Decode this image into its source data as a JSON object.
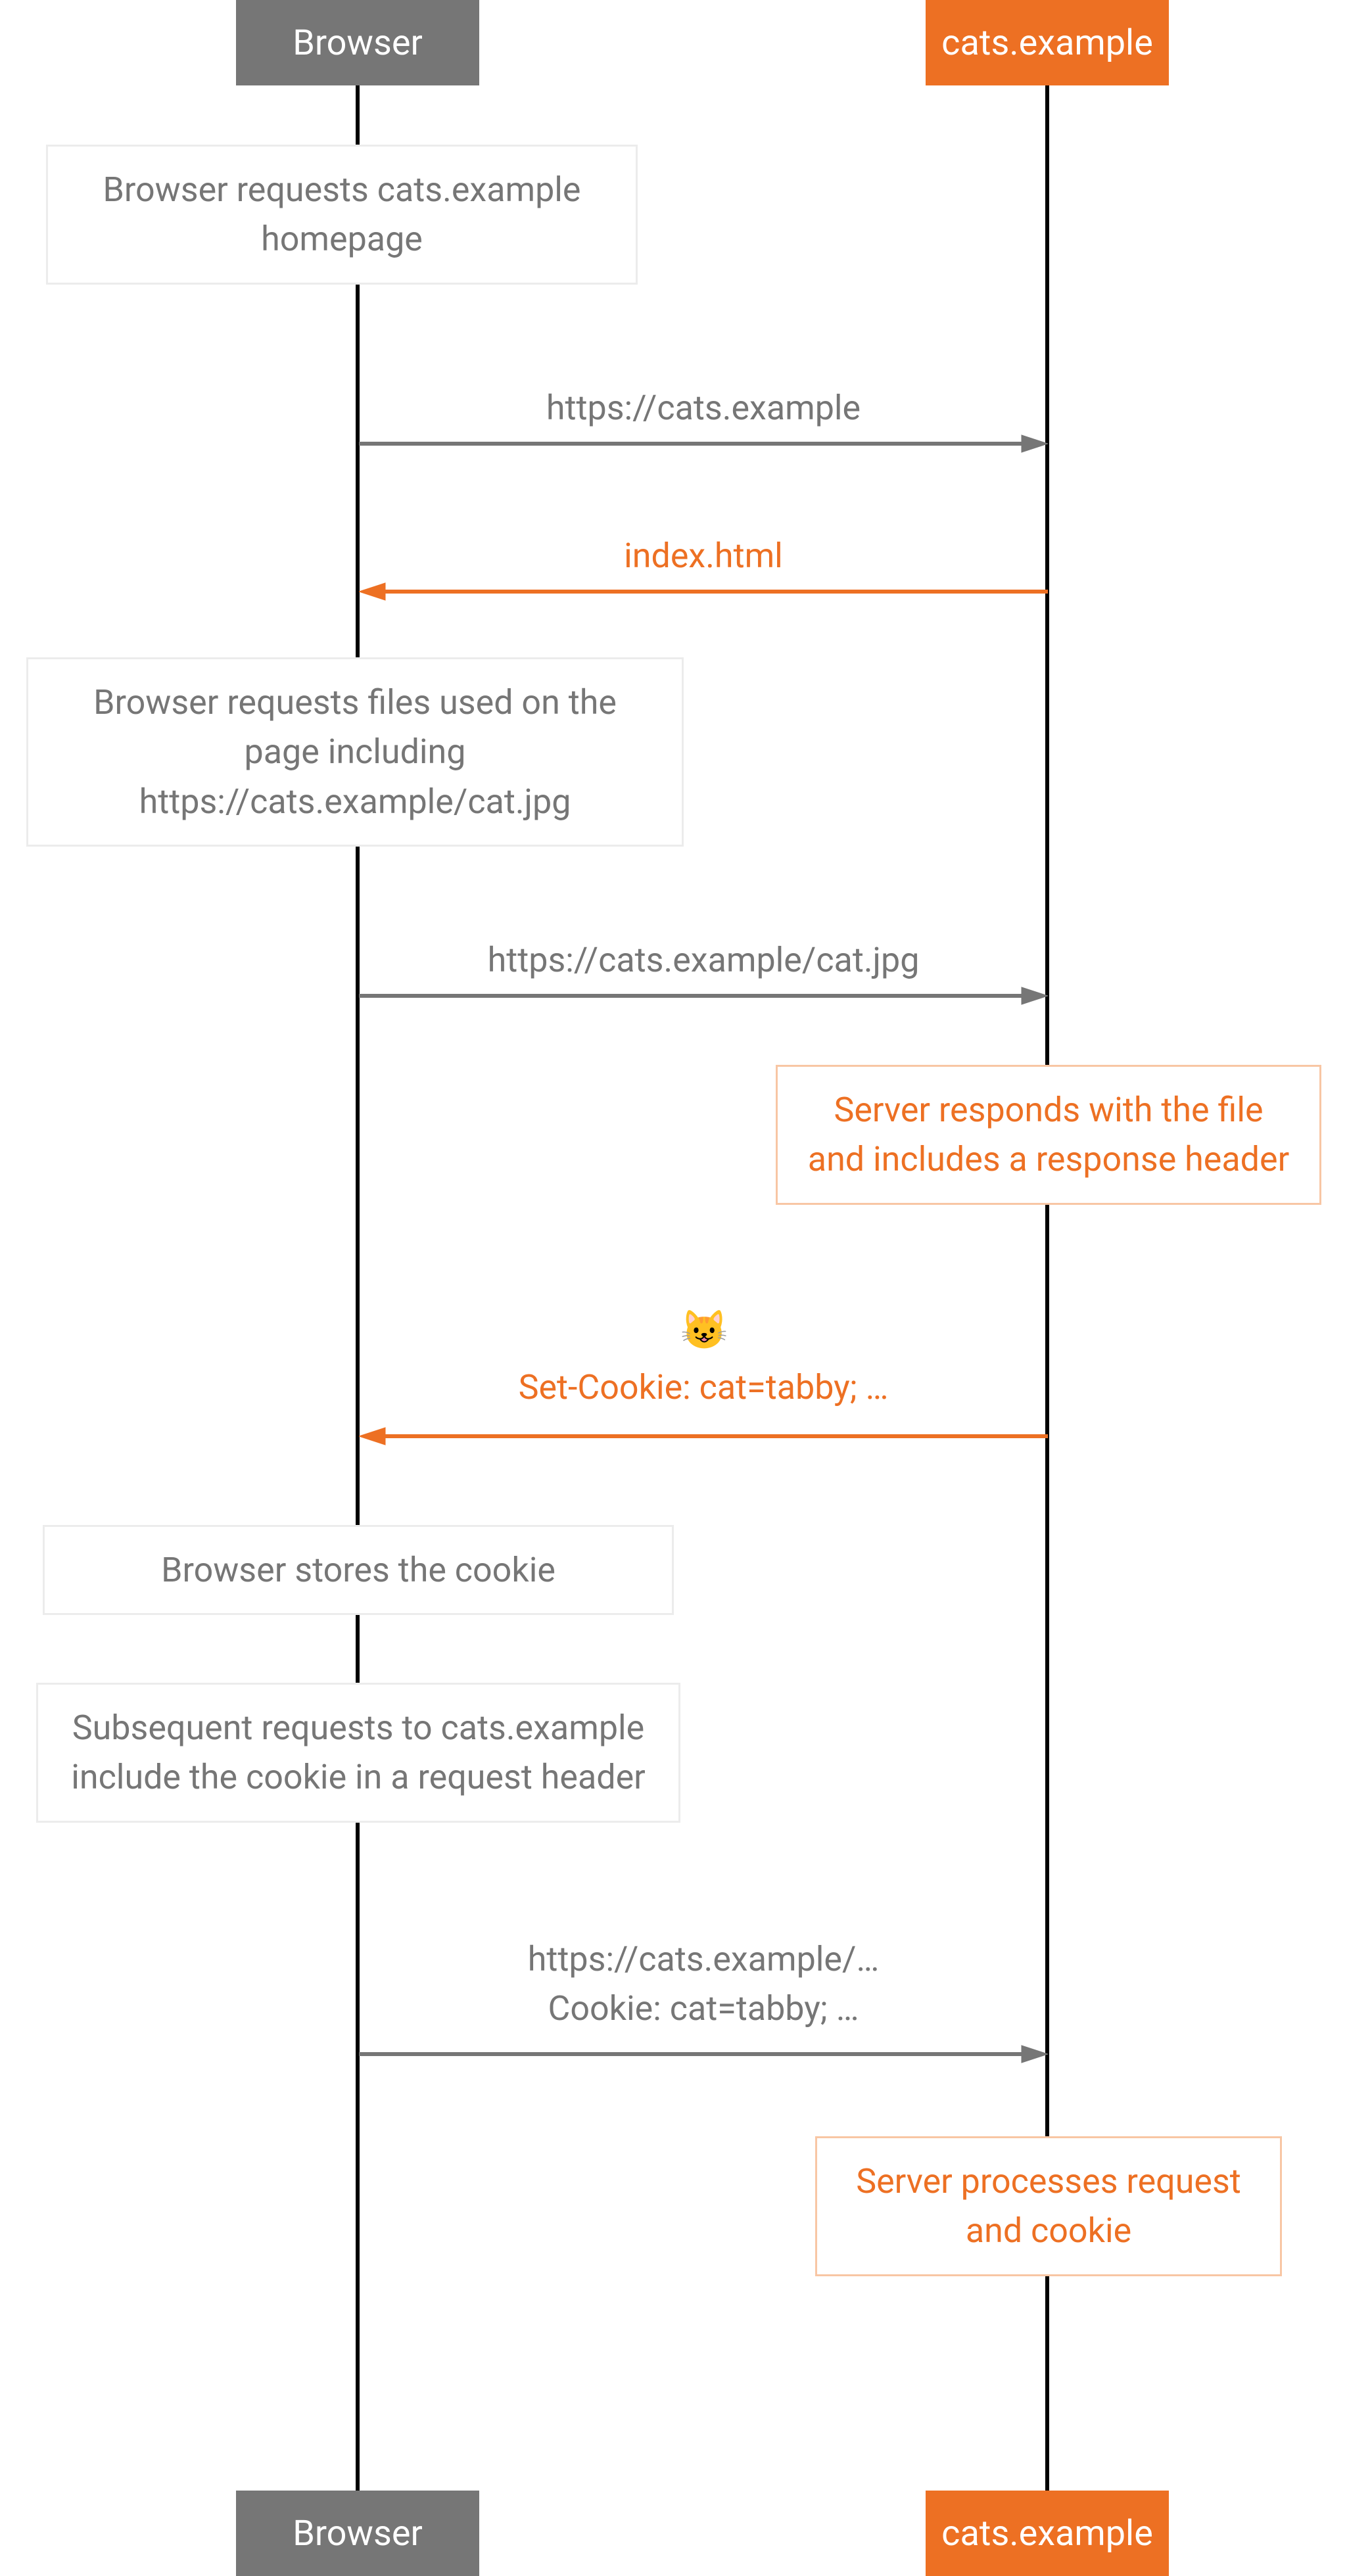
{
  "participants": {
    "browser": "Browser",
    "server": "cats.example"
  },
  "notes": {
    "n1": "Browser requests cats.example homepage",
    "n2": "Browser requests files used on the page including https://cats.example/cat.jpg",
    "n3": "Server responds with the file and includes a response header",
    "n4": "Browser stores the cookie",
    "n5": "Subsequent requests to cats.example include the cookie in a request header",
    "n6": "Server processes request and cookie"
  },
  "messages": {
    "m1": "https://cats.example",
    "m2": "index.html",
    "m3": "https://cats.example/cat.jpg",
    "m4": "Set-Cookie: cat=tabby; …",
    "m5a": "https://cats.example/…",
    "m5b": "Cookie: cat=tabby; …"
  },
  "emoji": "😺"
}
